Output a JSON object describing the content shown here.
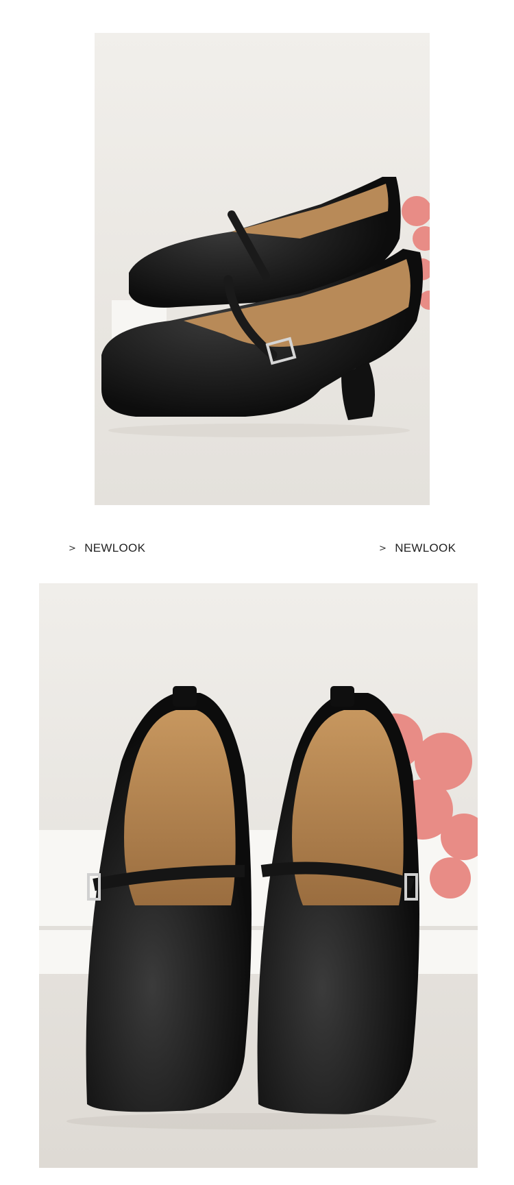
{
  "captions": [
    {
      "arrow": ">",
      "brand": "NEWLOOK"
    },
    {
      "arrow": ">",
      "brand": "NEWLOOK"
    }
  ],
  "photos": [
    {
      "name": "side-view",
      "subject": "black mary jane shoes side view"
    },
    {
      "name": "front-view",
      "subject": "black mary jane shoes front view"
    }
  ],
  "colors": {
    "background": "#ffffff",
    "photo_backdrop": "#eeebe6",
    "leather": "#141414",
    "lining": "#b88a58",
    "flowers": "#e88c86"
  }
}
